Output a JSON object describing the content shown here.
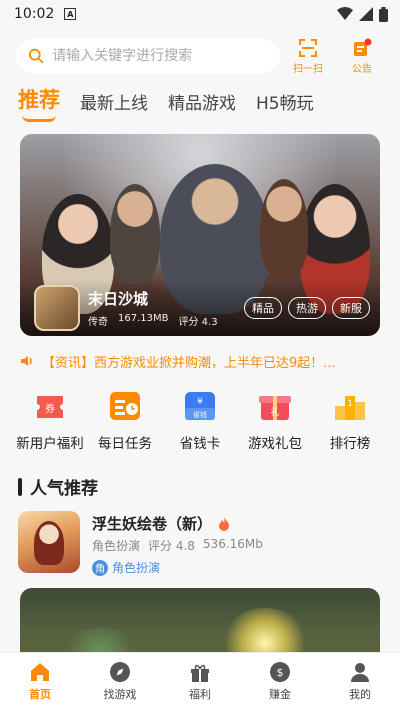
{
  "status_bar": {
    "time": "10:02",
    "notif_badge": "A"
  },
  "header": {
    "search_placeholder": "请输入关键字进行搜索",
    "scan_label": "扫一扫",
    "notice_label": "公告"
  },
  "tabs": [
    {
      "label": "推荐",
      "active": true
    },
    {
      "label": "最新上线",
      "active": false
    },
    {
      "label": "精品游戏",
      "active": false
    },
    {
      "label": "H5畅玩",
      "active": false
    }
  ],
  "banner": {
    "title": "末日沙城",
    "category": "传奇",
    "size": "167.13MB",
    "score": "评分 4.3",
    "tags": [
      "精品",
      "热游",
      "新服"
    ]
  },
  "notice": {
    "text": "【资讯】西方游戏业掀并购潮，上半年已达9起！..."
  },
  "quick_links": [
    {
      "label": "新用户福利",
      "icon": "gift-coupon-icon",
      "color": "#f65a4b"
    },
    {
      "label": "每日任务",
      "icon": "task-calendar-icon",
      "color": "#ff8a00"
    },
    {
      "label": "省钱卡",
      "icon": "money-card-icon",
      "color": "#3b7cf5"
    },
    {
      "label": "游戏礼包",
      "icon": "gift-box-icon",
      "color": "#f54b5c"
    },
    {
      "label": "排行榜",
      "icon": "podium-icon",
      "color": "#ffb100"
    }
  ],
  "section": {
    "title": "人气推荐"
  },
  "game": {
    "title": "浮生妖绘卷（新）",
    "category": "角色扮演",
    "score": "评分 4.8",
    "size": "536.16Mb",
    "genre_badge": "角",
    "genre_tag": "角色扮演"
  },
  "bottom_nav": [
    {
      "label": "首页",
      "icon": "home-icon",
      "active": true
    },
    {
      "label": "找游戏",
      "icon": "compass-icon",
      "active": false
    },
    {
      "label": "福利",
      "icon": "gift-icon",
      "active": false
    },
    {
      "label": "赚金",
      "icon": "money-bag-icon",
      "active": false
    },
    {
      "label": "我的",
      "icon": "user-icon",
      "active": false
    }
  ],
  "colors": {
    "accent": "#ff8a00",
    "link": "#4a90e2"
  }
}
